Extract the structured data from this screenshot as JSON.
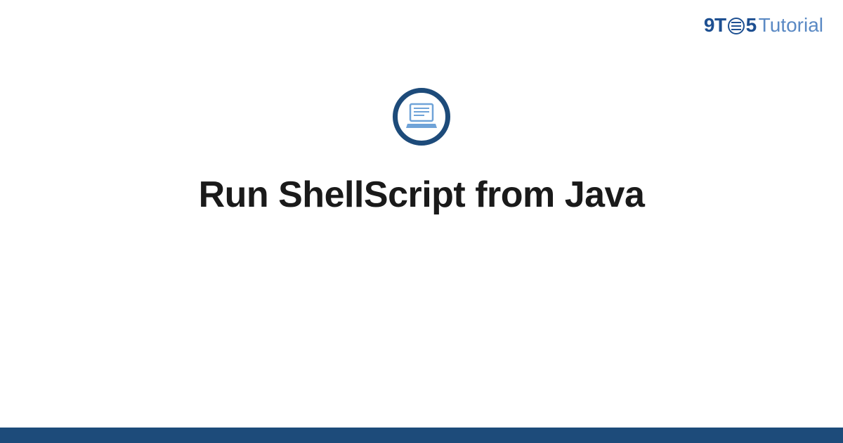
{
  "brand": {
    "part1": "9T",
    "part2": "5",
    "part3": "Tutorial"
  },
  "title": "Run ShellScript from Java"
}
